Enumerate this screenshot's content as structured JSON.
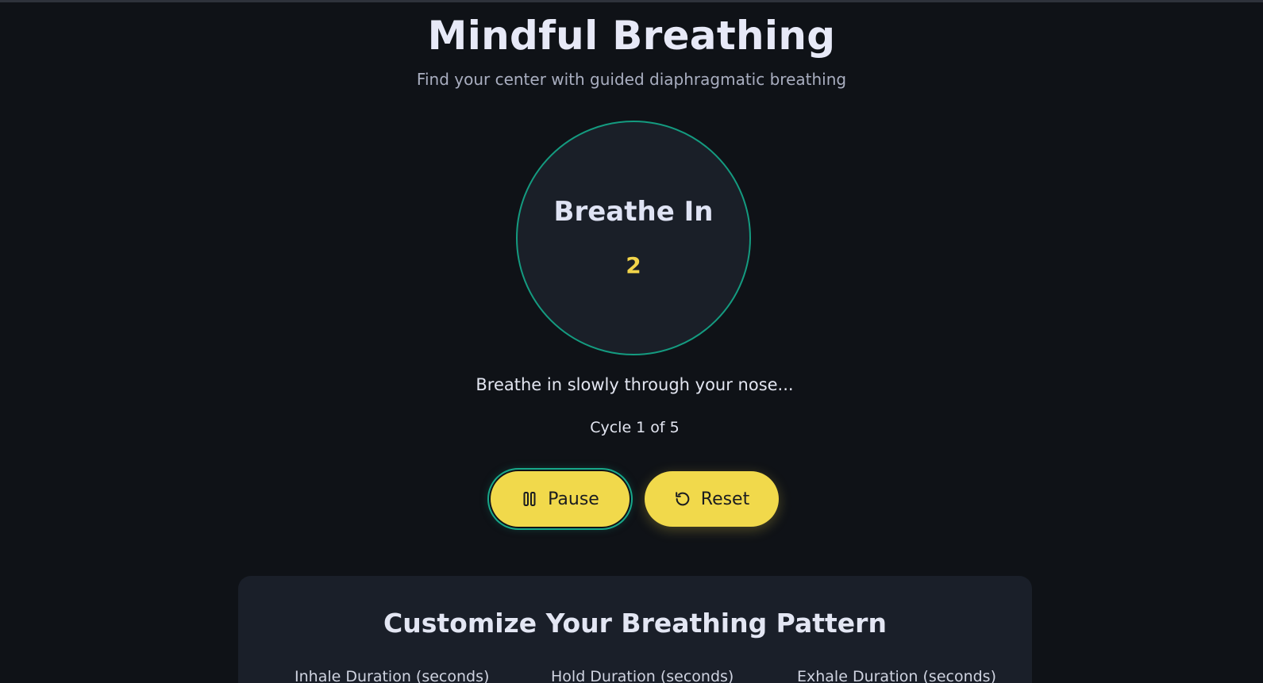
{
  "header": {
    "title": "Mindful Breathing",
    "subtitle": "Find your center with guided diaphragmatic breathing"
  },
  "session": {
    "phase": "Breathe In",
    "count": "2",
    "instruction": "Breathe in slowly through your nose...",
    "cycle_text": "Cycle 1 of 5"
  },
  "controls": {
    "pause_label": "Pause",
    "pause_icon": "pause-icon",
    "reset_label": "Reset",
    "reset_icon": "reset-icon"
  },
  "customize": {
    "title": "Customize Your Breathing Pattern",
    "fields": [
      {
        "label": "Inhale Duration (seconds)"
      },
      {
        "label": "Hold Duration (seconds)"
      },
      {
        "label": "Exhale Duration (seconds)"
      }
    ]
  },
  "colors": {
    "background": "#0f1217",
    "accent_teal": "#149b80",
    "accent_yellow": "#f1d94b",
    "panel": "#1a1f29"
  }
}
